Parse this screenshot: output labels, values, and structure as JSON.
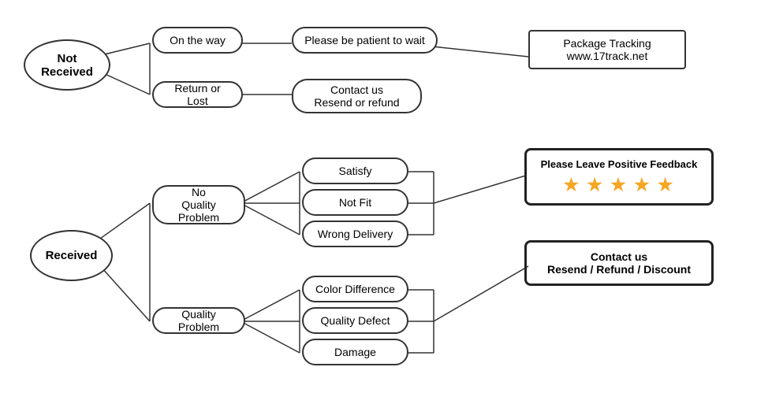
{
  "nodes": {
    "not_received": {
      "label": "Not\nReceived"
    },
    "on_the_way": {
      "label": "On the way"
    },
    "return_or_lost": {
      "label": "Return or Lost"
    },
    "please_wait": {
      "label": "Please be patient to wait"
    },
    "contact_resend_refund": {
      "label": "Contact us\nResend or refund"
    },
    "package_tracking": {
      "label": "Package Tracking\nwww.17track.net"
    },
    "received": {
      "label": "Received"
    },
    "no_quality_problem": {
      "label": "No\nQuality Problem"
    },
    "quality_problem": {
      "label": "Quality Problem"
    },
    "satisfy": {
      "label": "Satisfy"
    },
    "not_fit": {
      "label": "Not Fit"
    },
    "wrong_delivery": {
      "label": "Wrong Delivery"
    },
    "color_difference": {
      "label": "Color Difference"
    },
    "quality_defect": {
      "label": "Quality Defect"
    },
    "damage": {
      "label": "Damage"
    },
    "please_leave_feedback": {
      "label": "Please Leave Positive Feedback"
    },
    "stars": {
      "value": "★ ★ ★ ★ ★"
    },
    "contact_resend_refund_discount": {
      "label": "Contact us\nResend / Refund / Discount"
    }
  }
}
